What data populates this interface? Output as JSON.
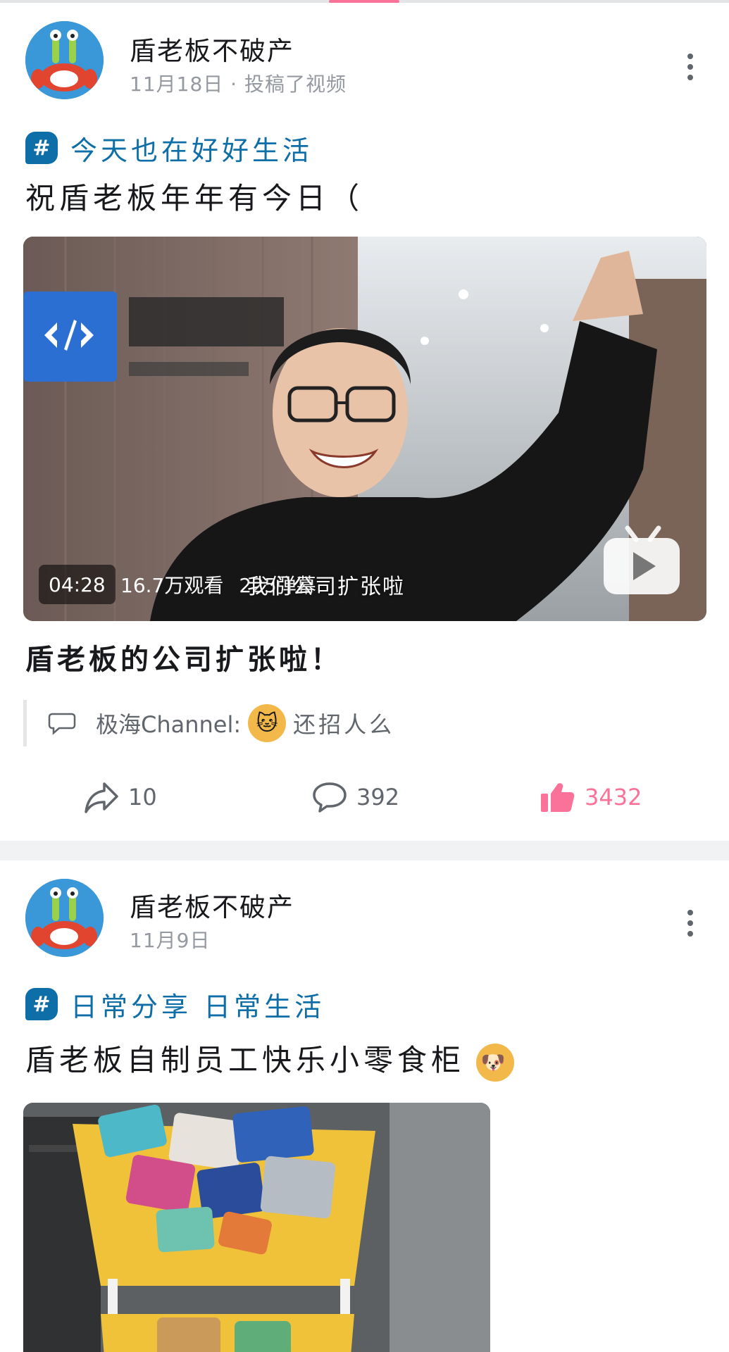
{
  "tabs_indicator": {
    "accent": "#fb7299"
  },
  "posts": [
    {
      "author": "盾老板不破产",
      "meta": "11月18日 · 投稿了视频",
      "topic": "今天也在好好生活",
      "text": "祝盾老板年年有今日（",
      "video": {
        "duration": "04:28",
        "views": "16.7万观看",
        "danmaku": "225弹幕",
        "subtitle": "我们公司扩张啦",
        "title": "盾老板的公司扩张啦！"
      },
      "comment": {
        "user": "极海Channel:",
        "text": "还招人么"
      },
      "stats": {
        "forward": "10",
        "comments": "392",
        "likes": "3432"
      }
    },
    {
      "author": "盾老板不破产",
      "meta": "11月9日",
      "topics": "日常分享 日常生活",
      "text": "盾老板自制员工快乐小零食柜"
    }
  ],
  "colors": {
    "accent": "#fb7299",
    "topic": "#0e6ea8",
    "muted": "#9499a0"
  },
  "icons": [
    "more-icon",
    "topic-hash-icon",
    "tv-play-icon",
    "comment-icon",
    "forward-icon",
    "like-icon",
    "emoji-cat",
    "emoji-dog"
  ]
}
